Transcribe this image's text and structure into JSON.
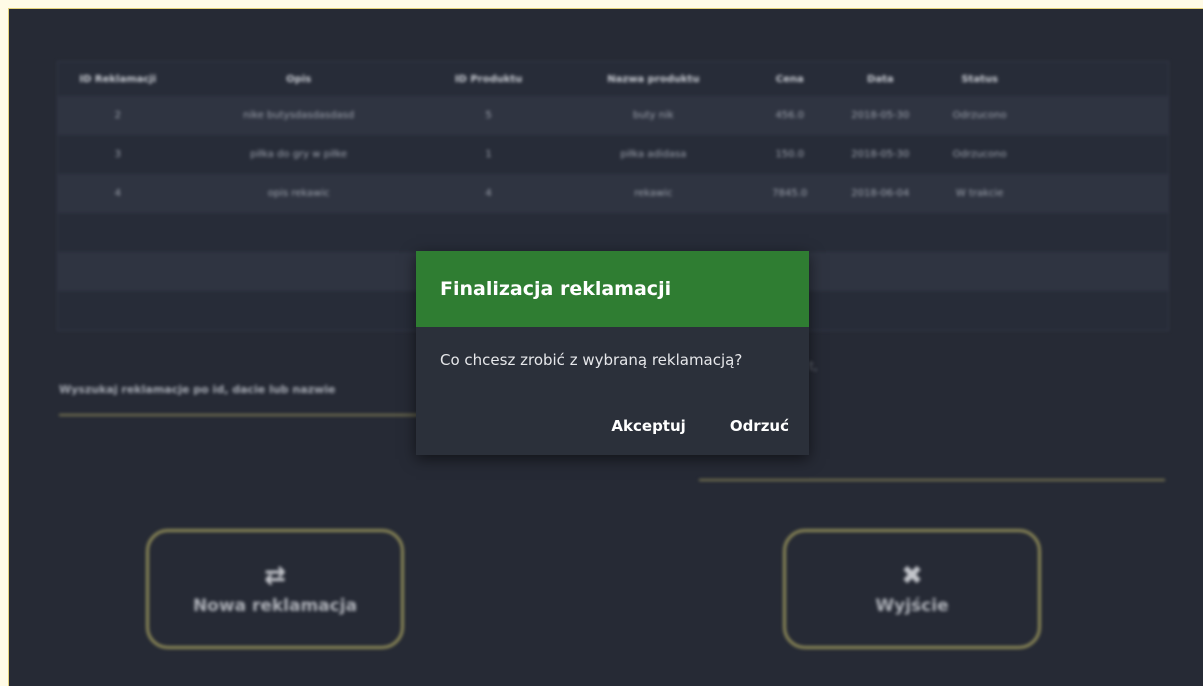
{
  "table": {
    "headers": [
      "ID Reklamacji",
      "Opis",
      "ID Produktu",
      "Nazwa produktu",
      "Cena",
      "Data",
      "Status"
    ],
    "rows": [
      [
        "2",
        "nike butysdasdasdasd",
        "5",
        "buty nik",
        "456.0",
        "2018-05-30",
        "Odrzucono"
      ],
      [
        "3",
        "piłka do gry w piłke",
        "1",
        "piłka adidasa",
        "150.0",
        "2018-05-30",
        "Odrzucono"
      ],
      [
        "4",
        "opis rekawic",
        "4",
        "rekawic",
        "7845.0",
        "2018-06-04",
        "W trakcie"
      ],
      [
        "",
        "",
        "",
        "",
        "",
        "",
        ""
      ],
      [
        "",
        "",
        "",
        "",
        "",
        "",
        ""
      ],
      [
        "",
        "",
        "",
        "",
        "",
        "",
        ""
      ]
    ]
  },
  "search": {
    "label": "Wyszukaj reklamacje po id, dacie lub nazwie"
  },
  "stray_text": "t,",
  "buttons": {
    "new_claim": {
      "label": "Nowa reklamacja",
      "icon": "swap-arrows-icon"
    },
    "exit": {
      "label": "Wyjście",
      "icon": "close-x-icon"
    }
  },
  "dialog": {
    "title": "Finalizacja reklamacji",
    "message": "Co chcesz zrobić z wybraną reklamacją?",
    "accept_label": "Akceptuj",
    "reject_label": "Odrzuć",
    "header_color": "#2f7d32"
  }
}
